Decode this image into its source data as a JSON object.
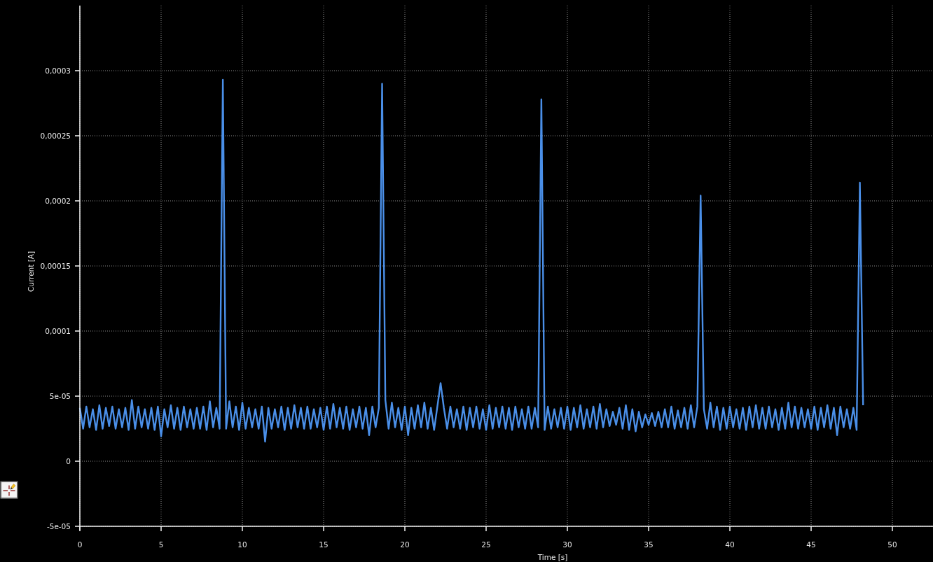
{
  "chart_data": {
    "type": "line",
    "grid": true,
    "xlabel": "Time [s]",
    "ylabel": "Current [A]",
    "xlim": [
      0,
      52.5
    ],
    "ylim": [
      -5e-05,
      0.00035
    ],
    "xticks": [
      0,
      5,
      10,
      15,
      20,
      25,
      30,
      35,
      40,
      45,
      50
    ],
    "yticks": [
      {
        "value": -5e-05,
        "label": "-5e-05"
      },
      {
        "value": 0,
        "label": "0"
      },
      {
        "value": 5e-05,
        "label": "5e-05"
      },
      {
        "value": 0.0001,
        "label": "0,0001"
      },
      {
        "value": 0.00015,
        "label": "0,00015"
      },
      {
        "value": 0.0002,
        "label": "0,0002"
      },
      {
        "value": 0.00025,
        "label": "0,00025"
      },
      {
        "value": 0.0003,
        "label": "0,0003"
      }
    ],
    "x": [
      0,
      0.2,
      0.4,
      0.6,
      0.8,
      1,
      1.2,
      1.4,
      1.6,
      1.8,
      2,
      2.2,
      2.4,
      2.6,
      2.8,
      3,
      3.2,
      3.4,
      3.6,
      3.8,
      4,
      4.2,
      4.4,
      4.6,
      4.8,
      5,
      5.2,
      5.4,
      5.6,
      5.8,
      6,
      6.2,
      6.4,
      6.6,
      6.8,
      7,
      7.2,
      7.4,
      7.6,
      7.8,
      8,
      8.2,
      8.4,
      8.6,
      8.8,
      9,
      9.2,
      9.4,
      9.6,
      9.8,
      10,
      10.2,
      10.4,
      10.6,
      10.8,
      11,
      11.2,
      11.4,
      11.6,
      11.8,
      12,
      12.2,
      12.4,
      12.6,
      12.8,
      13,
      13.2,
      13.4,
      13.6,
      13.8,
      14,
      14.2,
      14.4,
      14.6,
      14.8,
      15,
      15.2,
      15.4,
      15.6,
      15.8,
      16,
      16.2,
      16.4,
      16.6,
      16.8,
      17,
      17.2,
      17.4,
      17.6,
      17.8,
      18,
      18.2,
      18.4,
      18.6,
      18.8,
      19,
      19.2,
      19.4,
      19.6,
      19.8,
      20,
      20.2,
      20.4,
      20.6,
      20.8,
      21,
      21.2,
      21.4,
      21.6,
      21.8,
      22,
      22.2,
      22.4,
      22.6,
      22.8,
      23,
      23.2,
      23.4,
      23.6,
      23.8,
      24,
      24.2,
      24.4,
      24.6,
      24.8,
      25,
      25.2,
      25.4,
      25.6,
      25.8,
      26,
      26.2,
      26.4,
      26.6,
      26.8,
      27,
      27.2,
      27.4,
      27.6,
      27.8,
      28,
      28.2,
      28.4,
      28.6,
      28.8,
      29,
      29.2,
      29.4,
      29.6,
      29.8,
      30,
      30.2,
      30.4,
      30.6,
      30.8,
      31,
      31.2,
      31.4,
      31.6,
      31.8,
      32,
      32.2,
      32.4,
      32.6,
      32.8,
      33,
      33.2,
      33.4,
      33.6,
      33.8,
      34,
      34.2,
      34.4,
      34.6,
      34.8,
      35,
      35.2,
      35.4,
      35.6,
      35.8,
      36,
      36.2,
      36.4,
      36.6,
      36.8,
      37,
      37.2,
      37.4,
      37.6,
      37.8,
      38,
      38.2,
      38.4,
      38.6,
      38.8,
      39,
      39.2,
      39.4,
      39.6,
      39.8,
      40,
      40.2,
      40.4,
      40.6,
      40.8,
      41,
      41.2,
      41.4,
      41.6,
      41.8,
      42,
      42.2,
      42.4,
      42.6,
      42.8,
      43,
      43.2,
      43.4,
      43.6,
      43.8,
      44,
      44.2,
      44.4,
      44.6,
      44.8,
      45,
      45.2,
      45.4,
      45.6,
      45.8,
      46,
      46.2,
      46.4,
      46.6,
      46.8,
      47,
      47.2,
      47.4,
      47.6,
      47.8,
      48,
      48.2
    ],
    "series": [
      {
        "color": "#4a8fe8",
        "values": [
          4.1e-05,
          2.5e-05,
          4.2e-05,
          2.6e-05,
          4e-05,
          2.4e-05,
          4.3e-05,
          2.5e-05,
          4.1e-05,
          2.7e-05,
          4.2e-05,
          2.5e-05,
          4e-05,
          2.6e-05,
          4.1e-05,
          2.4e-05,
          4.7e-05,
          2.5e-05,
          4.2e-05,
          2.6e-05,
          4e-05,
          2.5e-05,
          4.1e-05,
          2.4e-05,
          4.2e-05,
          1.9e-05,
          4e-05,
          2.6e-05,
          4.3e-05,
          2.5e-05,
          4.1e-05,
          2.4e-05,
          4.2e-05,
          2.6e-05,
          4e-05,
          2.5e-05,
          4.1e-05,
          2.5e-05,
          4.2e-05,
          2.4e-05,
          4.6e-05,
          2.6e-05,
          4.1e-05,
          2.5e-05,
          0.000293,
          2.5e-05,
          4.6e-05,
          2.6e-05,
          4.2e-05,
          2.4e-05,
          4.5e-05,
          2.5e-05,
          4.1e-05,
          2.6e-05,
          4e-05,
          2.5e-05,
          4.2e-05,
          1.5e-05,
          4.1e-05,
          2.5e-05,
          4e-05,
          2.6e-05,
          4.2e-05,
          2.4e-05,
          4.1e-05,
          2.5e-05,
          4.3e-05,
          2.6e-05,
          4.1e-05,
          2.5e-05,
          4.2e-05,
          2.5e-05,
          4e-05,
          2.6e-05,
          4.1e-05,
          2.4e-05,
          4.2e-05,
          2.5e-05,
          4.4e-05,
          2.6e-05,
          4.1e-05,
          2.5e-05,
          4.2e-05,
          2.4e-05,
          4e-05,
          2.6e-05,
          4.2e-05,
          2.5e-05,
          4.1e-05,
          2e-05,
          4.2e-05,
          2.6e-05,
          4.1e-05,
          0.00029,
          4.7e-05,
          2.5e-05,
          4.5e-05,
          2.6e-05,
          4.1e-05,
          2.4e-05,
          4.2e-05,
          2e-05,
          4.1e-05,
          2.5e-05,
          4.3e-05,
          2.6e-05,
          4.5e-05,
          2.5e-05,
          4.1e-05,
          2.4e-05,
          4.2e-05,
          6e-05,
          4.1e-05,
          2.5e-05,
          4.2e-05,
          2.6e-05,
          4e-05,
          2.5e-05,
          4.2e-05,
          2.4e-05,
          4.1e-05,
          2.6e-05,
          4.2e-05,
          2.5e-05,
          4e-05,
          2.4e-05,
          4.3e-05,
          2.5e-05,
          4.1e-05,
          2.6e-05,
          4.2e-05,
          2.5e-05,
          4.1e-05,
          2.4e-05,
          4.2e-05,
          2.6e-05,
          4e-05,
          2.5e-05,
          4.2e-05,
          2.5e-05,
          4.1e-05,
          2.6e-05,
          0.000278,
          2.4e-05,
          4.2e-05,
          2.5e-05,
          4e-05,
          2.6e-05,
          4.1e-05,
          2.5e-05,
          4.2e-05,
          2.4e-05,
          4.1e-05,
          2.6e-05,
          4.3e-05,
          2.5e-05,
          4e-05,
          2.6e-05,
          4.2e-05,
          2.5e-05,
          4.4e-05,
          2.6e-05,
          4e-05,
          2.7e-05,
          3.8e-05,
          2.8e-05,
          4.1e-05,
          2.5e-05,
          4.3e-05,
          2.4e-05,
          4e-05,
          2.3e-05,
          3.8e-05,
          2.6e-05,
          3.6e-05,
          2.8e-05,
          3.7e-05,
          2.7e-05,
          3.8e-05,
          2.6e-05,
          4e-05,
          2.6e-05,
          4.2e-05,
          2.5e-05,
          3.9e-05,
          2.6e-05,
          4.1e-05,
          2.5e-05,
          4.3e-05,
          2.6e-05,
          4.2e-05,
          0.000204,
          4e-05,
          2.5e-05,
          4.5e-05,
          2.6e-05,
          4.2e-05,
          2.4e-05,
          4.1e-05,
          2.5e-05,
          4.2e-05,
          2.6e-05,
          4e-05,
          2.5e-05,
          4.1e-05,
          2.4e-05,
          4.2e-05,
          2.6e-05,
          4.3e-05,
          2.5e-05,
          4.1e-05,
          2.5e-05,
          4.2e-05,
          2.6e-05,
          4e-05,
          2.4e-05,
          4.1e-05,
          2.5e-05,
          4.5e-05,
          2.6e-05,
          4.2e-05,
          2.5e-05,
          4.1e-05,
          2.6e-05,
          4e-05,
          2.5e-05,
          4.2e-05,
          2.4e-05,
          4.1e-05,
          2.6e-05,
          4.3e-05,
          2.5e-05,
          4.1e-05,
          2e-05,
          4.2e-05,
          2.6e-05,
          4e-05,
          2.5e-05,
          4.1e-05,
          2.4e-05,
          0.000214,
          4.3e-05
        ]
      }
    ]
  }
}
